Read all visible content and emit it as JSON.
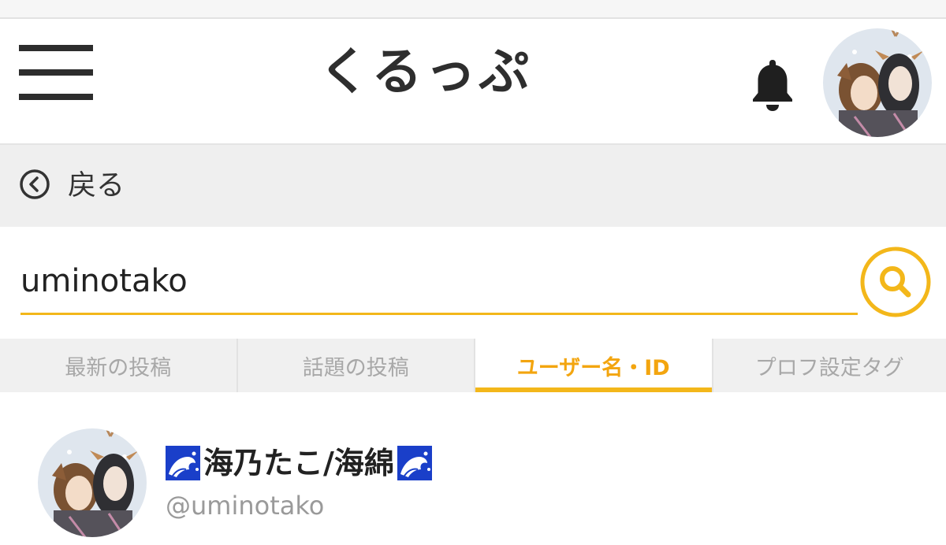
{
  "header": {
    "title": "くるっぷ",
    "menu_icon": "hamburger-menu-icon",
    "bell_icon": "bell-icon"
  },
  "back": {
    "label": "戻る",
    "icon": "chevron-left-circle-icon"
  },
  "search": {
    "value": "uminotako",
    "icon": "search-icon",
    "accent_color": "#f3b71a"
  },
  "tabs": [
    {
      "label": "最新の投稿",
      "active": false
    },
    {
      "label": "話題の投稿",
      "active": false
    },
    {
      "label": "ユーザー名・ID",
      "active": true
    },
    {
      "label": "プロフ設定タグ",
      "active": false
    }
  ],
  "results": [
    {
      "display_name": "海乃たこ/海綿",
      "handle": "@uminotako",
      "name_decoration_icon": "water-wave-icon"
    }
  ]
}
